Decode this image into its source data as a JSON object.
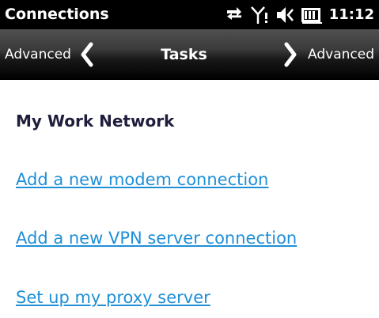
{
  "titlebar": {
    "app_title": "Connections",
    "clock": "11:12",
    "status_icons": [
      "data-sync-icon",
      "signal-strength-icon",
      "volume-muted-icon",
      "battery-icon"
    ]
  },
  "tabbar": {
    "prev_label": "Advanced",
    "current_label": "Tasks",
    "next_label": "Advanced"
  },
  "content": {
    "heading": "My Work Network",
    "links": [
      "Add a new modem connection",
      "Add a new VPN server connection",
      "Set up my proxy server"
    ]
  },
  "colors": {
    "link": "#1f8fd8",
    "heading": "#1e1e3c",
    "titlebar_bg": "#000000"
  }
}
